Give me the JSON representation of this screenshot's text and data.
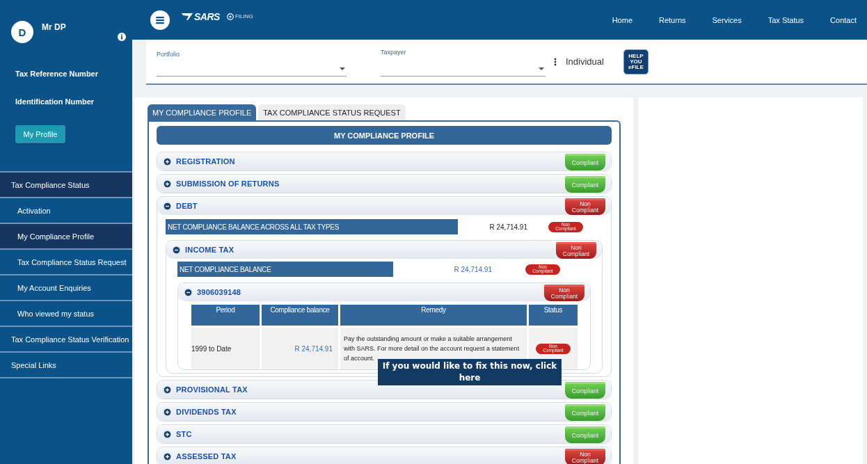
{
  "sidebar": {
    "user": {
      "initial": "D",
      "name": "Mr DP"
    },
    "fields": [
      "Tax Reference Number",
      "Identification Number"
    ],
    "profile_button": "My Profile",
    "menu": [
      {
        "label": "Tax Compliance Status",
        "selected": true,
        "children": [
          {
            "label": "Activation",
            "selected": false
          },
          {
            "label": "My Compliance Profile",
            "selected": true
          },
          {
            "label": "Tax Compliance Status Request",
            "selected": false
          },
          {
            "label": "My Account Enquiries",
            "selected": false
          },
          {
            "label": "Who viewed my status",
            "selected": false
          }
        ]
      },
      {
        "label": "Tax Compliance Status Verification",
        "selected": false
      },
      {
        "label": "Special Links",
        "selected": false
      }
    ]
  },
  "header": {
    "brand": "SARS",
    "product": "FILING",
    "nav": [
      "Home",
      "Returns",
      "Services",
      "Tax Status",
      "Contact"
    ]
  },
  "filters": {
    "portfolio": {
      "label": "Portfolio"
    },
    "taxpayer": {
      "label": "Taxpayer"
    },
    "taxpayer_type": "Individual",
    "help_badge": "HELP YOU eFILE"
  },
  "tabs": [
    {
      "label": "MY COMPLIANCE PROFILE",
      "selected": true
    },
    {
      "label": "TAX COMPLIANCE STATUS REQUEST",
      "selected": false
    }
  ],
  "profile": {
    "title": "MY COMPLIANCE PROFILE",
    "sections": [
      {
        "title": "REGISTRATION",
        "expanded": false,
        "status": {
          "kind": "compliant",
          "label": "Compliant"
        }
      },
      {
        "title": "SUBMISSION OF RETURNS",
        "expanded": false,
        "status": {
          "kind": "compliant",
          "label": "Compliant"
        }
      },
      {
        "title": "DEBT",
        "expanded": true,
        "status": {
          "kind": "non_compliant",
          "label": "Non Compliant"
        },
        "summary": {
          "label": "NET COMPLIANCE BALANCE ACROSS ALL TAX TYPES",
          "amount": "R 24,714.91",
          "status": {
            "kind": "non_compliant",
            "label": "Non Compliant"
          }
        },
        "children": [
          {
            "title": "INCOME TAX",
            "expanded": true,
            "status": {
              "kind": "non_compliant",
              "label": "Non Compliant"
            },
            "summary": {
              "label": "NET COMPLIANCE BALANCE",
              "amount": "R 24,714.91",
              "status": {
                "kind": "non_compliant",
                "label": "Non Compliant"
              }
            },
            "children": [
              {
                "title": "3906039148",
                "expanded": true,
                "status": {
                  "kind": "non_compliant",
                  "label": "Non Compliant"
                },
                "table": {
                  "columns": [
                    "Period",
                    "Compliance balance",
                    "Remedy",
                    "Status"
                  ],
                  "rows": [
                    {
                      "period": "1999 to Date",
                      "balance": "R 24,714.91",
                      "remedy": "Pay the outstanding amount or make a suitable arrangement with SARS. For more detail on the account request a statement of account.",
                      "status": {
                        "kind": "non_compliant",
                        "label": "Non Compliant"
                      }
                    }
                  ],
                  "tooltip": "If you would like to fix this now, click here"
                }
              }
            ]
          }
        ]
      },
      {
        "title": "PROVISIONAL TAX",
        "expanded": false,
        "status": {
          "kind": "compliant",
          "label": "Compliant"
        }
      },
      {
        "title": "DIVIDENDS TAX",
        "expanded": false,
        "status": {
          "kind": "compliant",
          "label": "Compliant"
        }
      },
      {
        "title": "STC",
        "expanded": false,
        "status": {
          "kind": "compliant",
          "label": "Compliant"
        }
      },
      {
        "title": "ASSESSED TAX",
        "expanded": false,
        "status": {
          "kind": "non_compliant",
          "label": "Non Compliant"
        }
      }
    ]
  }
}
